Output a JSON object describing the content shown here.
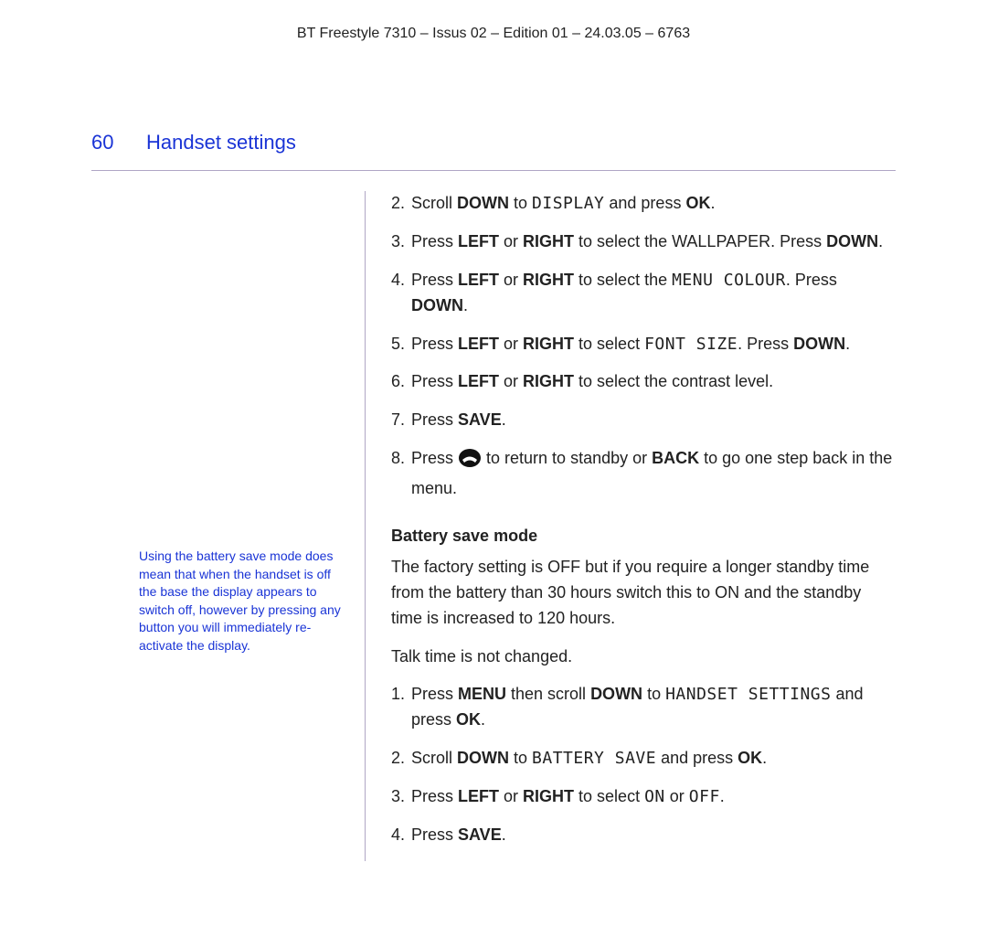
{
  "header": "BT Freestyle 7310 – Issus 02 – Edition 01 – 24.03.05 – 6763",
  "page_number": "60",
  "section_title": "Handset settings",
  "sidebar_note": "Using the battery save mode does mean that when the handset is off the base the display appears to switch off, however by pressing any button you will immediately re-activate the display.",
  "steps_top": {
    "s2a": "Scroll ",
    "s2b": "DOWN",
    "s2c": " to ",
    "s2d": "DISPLAY",
    "s2e": " and press ",
    "s2f": "OK",
    "s2g": ".",
    "s3a": "Press ",
    "s3b": "LEFT",
    "s3c": " or ",
    "s3d": "RIGHT",
    "s3e": " to select the WALLPAPER. Press ",
    "s3f": "DOWN",
    "s3g": ".",
    "s4a": "Press ",
    "s4b": "LEFT",
    "s4c": " or ",
    "s4d": "RIGHT",
    "s4e": " to select the ",
    "s4f": "MENU COLOUR",
    "s4g": ". Press ",
    "s4h": "DOWN",
    "s4i": ".",
    "s5a": "Press ",
    "s5b": "LEFT",
    "s5c": " or ",
    "s5d": "RIGHT",
    "s5e": " to select ",
    "s5f": "FONT SIZE",
    "s5g": ". Press ",
    "s5h": "DOWN",
    "s5i": ".",
    "s6a": "Press ",
    "s6b": "LEFT",
    "s6c": " or ",
    "s6d": "RIGHT",
    "s6e": " to select the contrast level.",
    "s7a": "Press ",
    "s7b": "SAVE",
    "s7c": ".",
    "s8a": "Press ",
    "s8b": " to return to standby or ",
    "s8c": "BACK",
    "s8d": " to go one step back in the menu."
  },
  "section2_heading": "Battery save mode",
  "section2_intro": "The factory setting is OFF but if you require a longer standby time from the battery than 30 hours switch this to ON and the standby time is increased to 120 hours.",
  "section2_intro2": "Talk time is not changed.",
  "steps_bottom": {
    "b1a": "Press ",
    "b1b": "MENU",
    "b1c": " then scroll ",
    "b1d": "DOWN",
    "b1e": " to ",
    "b1f": "HANDSET SETTINGS",
    "b1g": " and press ",
    "b1h": "OK",
    "b1i": ".",
    "b2a": "Scroll ",
    "b2b": "DOWN",
    "b2c": " to ",
    "b2d": "BATTERY SAVE",
    "b2e": " and press ",
    "b2f": "OK",
    "b2g": ".",
    "b3a": "Press ",
    "b3b": "LEFT",
    "b3c": " or ",
    "b3d": "RIGHT",
    "b3e": " to select ",
    "b3f": "ON",
    "b3g": " or ",
    "b3h": "OFF",
    "b3i": ".",
    "b4a": "Press ",
    "b4b": "SAVE",
    "b4c": "."
  },
  "nums": {
    "n2": "2.",
    "n3": "3.",
    "n4": "4.",
    "n5": "5.",
    "n6": "6.",
    "n7": "7.",
    "n8": "8.",
    "m1": "1.",
    "m2": "2.",
    "m3": "3.",
    "m4": "4."
  }
}
